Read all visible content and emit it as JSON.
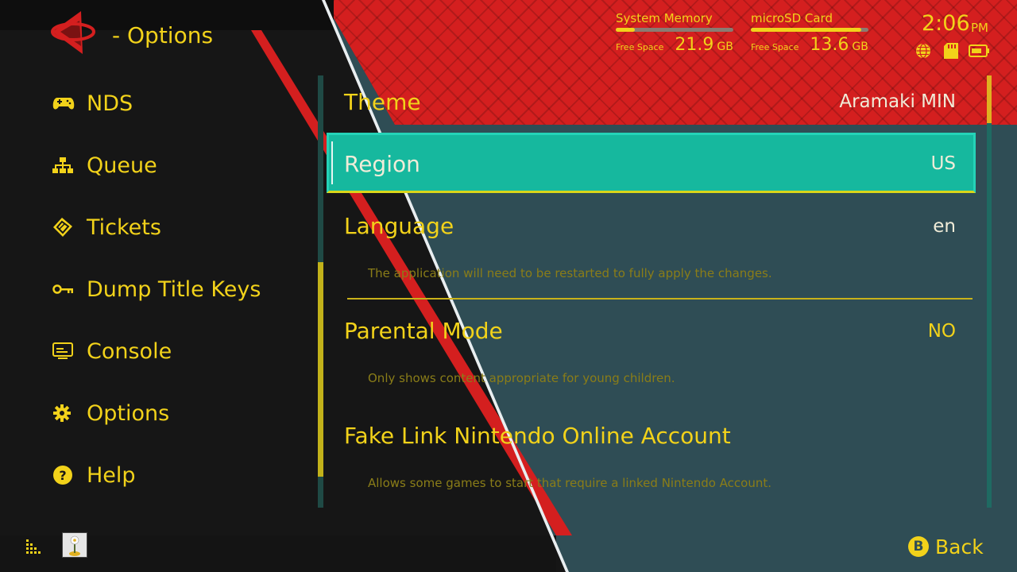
{
  "header": {
    "title": "- Options"
  },
  "storage": {
    "system": {
      "name": "System Memory",
      "free_label": "Free Space",
      "value": "21.9",
      "unit": "GB",
      "used_fraction": 0.16
    },
    "sd": {
      "name": "microSD Card",
      "free_label": "Free Space",
      "value": "13.6",
      "unit": "GB",
      "used_fraction": 0.94
    }
  },
  "clock": {
    "time": "2:06",
    "ampm": "PM"
  },
  "status_icons": [
    "globe-icon",
    "sd-card-icon",
    "battery-icon"
  ],
  "sidebar": {
    "items": [
      {
        "label": "NDS",
        "icon": "gamepad-icon"
      },
      {
        "label": "Queue",
        "icon": "hierarchy-icon"
      },
      {
        "label": "Tickets",
        "icon": "ticket-icon"
      },
      {
        "label": "Dump Title Keys",
        "icon": "key-icon"
      },
      {
        "label": "Console",
        "icon": "console-icon"
      },
      {
        "label": "Options",
        "icon": "gear-icon"
      },
      {
        "label": "Help",
        "icon": "help-icon"
      }
    ]
  },
  "options": {
    "theme": {
      "label": "Theme",
      "value": "Aramaki MIN"
    },
    "region": {
      "label": "Region",
      "value": "US"
    },
    "language": {
      "label": "Language",
      "value": "en",
      "desc": "The application will need to be restarted to fully apply the changes."
    },
    "parental": {
      "label": "Parental Mode",
      "value": "NO",
      "desc": "Only shows content appropriate for young children."
    },
    "fakelink": {
      "label": "Fake Link Nintendo Online Account",
      "desc": "Allows some games to start that require a linked Nintendo Account."
    }
  },
  "footer": {
    "back_button": "B",
    "back_label": "Back"
  },
  "colors": {
    "accent": "#f2d21a",
    "highlight": "#16b89e",
    "red": "#d41f1f",
    "panel": "#2f4d55",
    "sidebar": "#161616"
  }
}
